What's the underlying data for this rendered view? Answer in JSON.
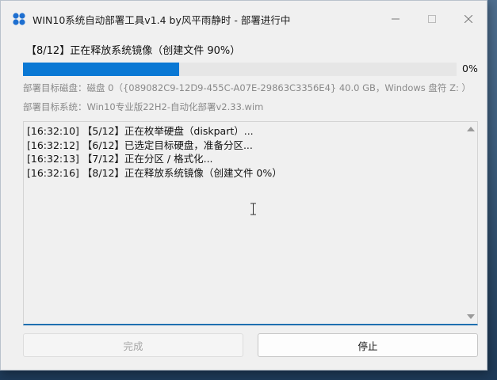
{
  "window": {
    "title": "WIN10系统自动部署工具v1.4 by风平雨静时 - 部署进行中",
    "icon": "app-logo-icon",
    "controls": {
      "minimize": "—",
      "maximize": "☐",
      "close": "✕"
    }
  },
  "status": {
    "current_step": "【8/12】正在释放系统镜像（创建文件 90%）",
    "progress_percent": 36,
    "progress_label": "0%"
  },
  "info": {
    "target_disk": "部署目标磁盘：磁盘 0（{089082C9-12D9-455C-A07E-29863C3356E4} 40.0 GB，Windows 盘符 Z: ）",
    "target_system": "部署目标系统：Win10专业版22H2-自动化部署v2.33.wim"
  },
  "log": {
    "lines": [
      "[16:32:10] 【5/12】正在枚举硬盘（diskpart）...",
      "[16:32:12] 【6/12】已选定目标硬盘，准备分区...",
      "[16:32:13] 【7/12】正在分区 / 格式化...",
      "[16:32:16] 【8/12】正在释放系统镜像（创建文件 0%）"
    ]
  },
  "buttons": {
    "done_label": "完成",
    "stop_label": "停止"
  },
  "colors": {
    "accent": "#0a78d4",
    "window_bg": "#f0f0f0",
    "muted_text": "#8a8a8a"
  }
}
